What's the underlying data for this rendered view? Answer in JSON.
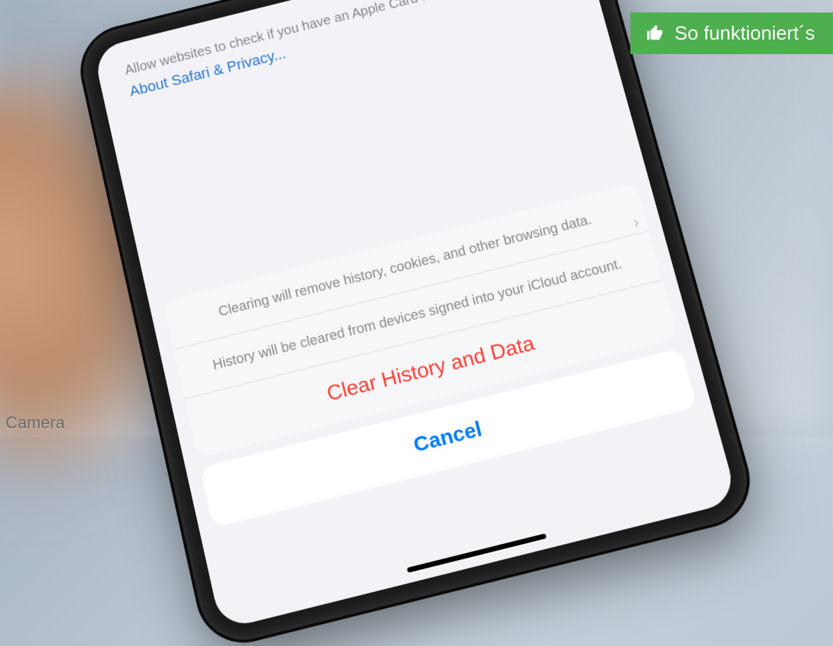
{
  "settings": {
    "allow_text": "Allow websites to check if you have an Apple Card account.",
    "privacy_link": "About Safari & Privacy..."
  },
  "sheet": {
    "message1": "Clearing will remove history, cookies, and other browsing data.",
    "message2": "History will be cleared from devices signed into your iCloud account.",
    "clear_label": "Clear History and Data",
    "cancel_label": "Cancel"
  },
  "badge": {
    "text": "So funktioniert´s"
  },
  "watermark": "Camera",
  "colors": {
    "destructive": "#ff3b30",
    "ios_blue": "#007aff",
    "badge_green": "#4daf4e"
  }
}
